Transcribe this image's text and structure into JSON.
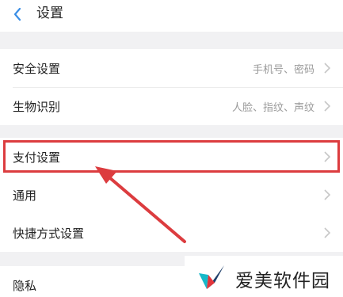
{
  "header": {
    "title": "设置"
  },
  "group1": [
    {
      "label": "安全设置",
      "value": "手机号、密码"
    },
    {
      "label": "生物识别",
      "value": "人脸、指纹、声纹"
    }
  ],
  "group2": [
    {
      "label": "支付设置",
      "value": ""
    },
    {
      "label": "通用",
      "value": ""
    },
    {
      "label": "快捷方式设置",
      "value": ""
    }
  ],
  "group3": [
    {
      "label": "隐私",
      "value": ""
    }
  ],
  "watermark": {
    "text": "爱美软件园"
  },
  "colors": {
    "highlight": "#dc3c3f",
    "back_chevron": "#3a8ee6",
    "chevron": "#c7c7c7"
  }
}
